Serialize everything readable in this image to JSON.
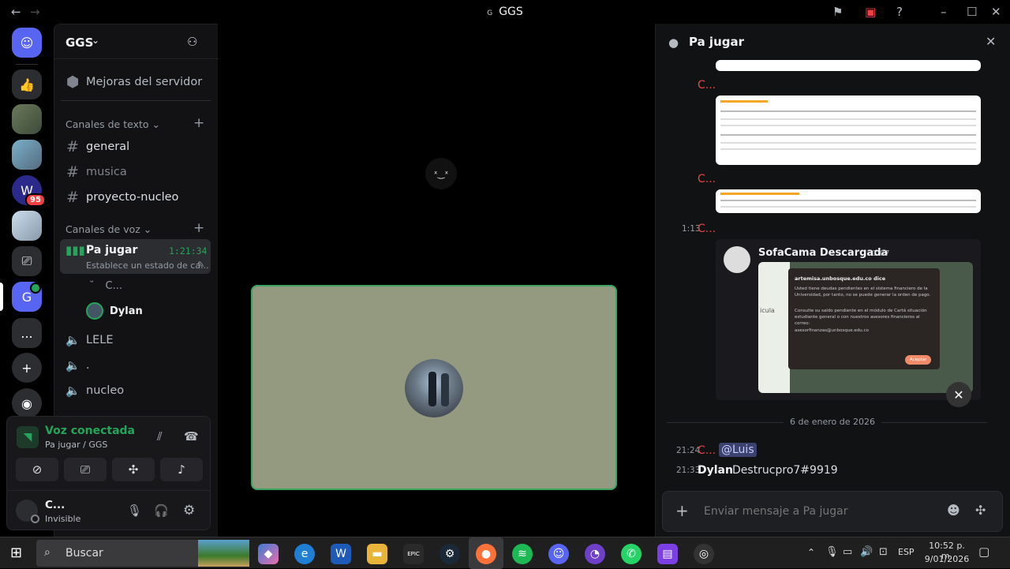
{
  "window": {
    "title": "GGS",
    "title_glyph": "G"
  },
  "server": {
    "name": "GGS",
    "boost_label": "Mejoras del servidor"
  },
  "text_category": "Canales de texto",
  "text_channels": [
    {
      "name": "general"
    },
    {
      "name": "musica"
    },
    {
      "name": "proyecto-nucleo"
    }
  ],
  "voice_category": "Canales de voz",
  "active_voice": {
    "name": "Pa jugar",
    "timer": "1:21:34",
    "status": "Establece un estado de ca..."
  },
  "voice_members": [
    {
      "name": "C..."
    },
    {
      "name": "Dylan"
    }
  ],
  "voice_channels": [
    {
      "name": "LELE"
    },
    {
      "name": "."
    },
    {
      "name": "nucleo"
    }
  ],
  "voice_panel": {
    "status": "Voz conectada",
    "location": "Pa jugar / GGS"
  },
  "user": {
    "name": "C...",
    "status": "Invisible"
  },
  "rail": {
    "badge": "95",
    "more": "..."
  },
  "chat": {
    "channel": "Pa jugar",
    "input_placeholder": "Enviar mensaje a Pa jugar",
    "messages": [
      {
        "author": "C..."
      },
      {
        "author": "C..."
      },
      {
        "time": "1:13",
        "author": "C..."
      }
    ],
    "embed": {
      "author": "SofaCama Descargada",
      "time": "1:07",
      "dialog_title": "artemisa.unbosque.edu.co dice",
      "dialog_body": "Usted tiene deudas pendientes en el sistema financiero de la Universidad, por tanto, no se puede generar la orden de pago.",
      "dialog_body2": "Consulte su saldo pendiente en el módulo de Cartá situación estudiante general o con nuestros asesores financieros al correo:",
      "dialog_email": "asesorfinanzas@unbosque.edu.co",
      "dialog_button": "Aceptar",
      "side_text": "icula"
    },
    "date_divider": "6 de enero de 2026",
    "recent": [
      {
        "time": "21:24",
        "author": "C...",
        "mention": "@Luis"
      },
      {
        "time": "21:33",
        "author": "Dylan",
        "text": "Destrucpro7#9919"
      }
    ]
  },
  "taskbar": {
    "search": "Buscar",
    "lang": "ESP",
    "time": "10:52 p. m.",
    "date": "9/01/2026",
    "epic": "EPIC"
  }
}
